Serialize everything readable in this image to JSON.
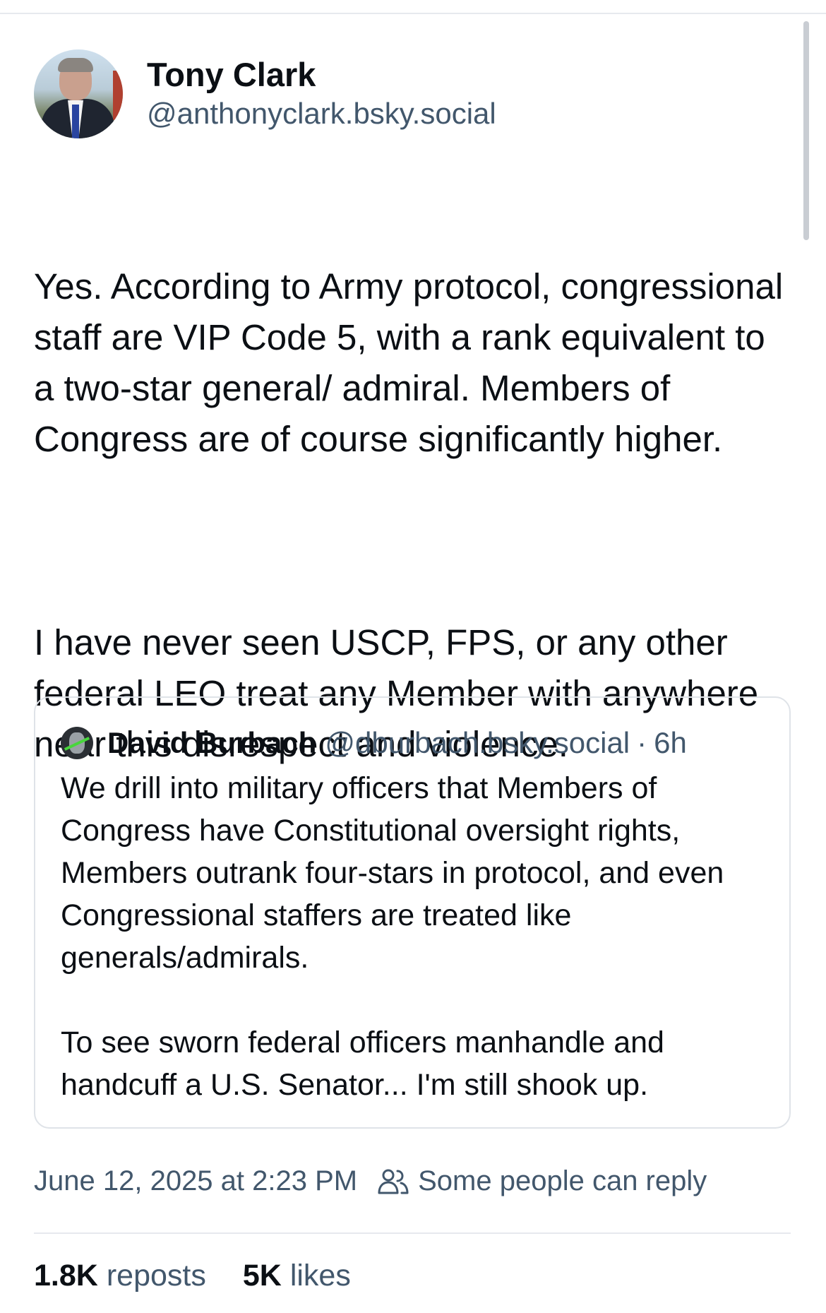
{
  "post": {
    "author": {
      "display_name": "Tony Clark",
      "handle": "@anthonyclark.bsky.social"
    },
    "paragraphs": [
      "Yes. According to Army protocol, congressional staff are VIP Code 5, with a rank equivalent to a two-star general/ admiral. Members of Congress are of course significantly higher.",
      "I have never seen USCP, FPS, or any other federal LEO treat any Member with anywhere near this disrespect and violence."
    ],
    "timestamp": "June 12, 2025 at 2:23 PM",
    "reply_setting": "Some people can reply",
    "reply_setting_icon": "people-icon",
    "stats": {
      "reposts_count": "1.8K",
      "reposts_label": "reposts",
      "likes_count": "5K",
      "likes_label": "likes"
    }
  },
  "quote": {
    "author": {
      "display_name": "David Burbach",
      "handle": "@dburbach.bsky.social",
      "separator": "·",
      "time": "6h"
    },
    "paragraphs": [
      "We drill into military officers that Members of Congress have Constitutional oversight rights, Members outrank four-stars in protocol, and even Congressional staffers are treated like generals/admirals.",
      "To see sworn federal officers manhandle and handcuff a U.S. Senator... I'm still shook up."
    ]
  },
  "colors": {
    "text_primary": "#0b0f14",
    "text_secondary": "#42576c",
    "border": "#dfe3e8"
  }
}
